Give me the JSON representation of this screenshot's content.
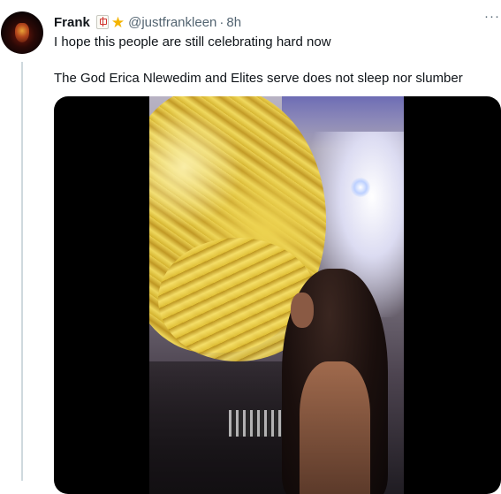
{
  "tweet": {
    "author": {
      "display_name": "Frank",
      "badges": [
        "mahjong-tile-emoji",
        "star-emoji"
      ],
      "handle": "@justfrankleen",
      "separator": "·",
      "time": "8h"
    },
    "more_menu": "···",
    "lines": [
      "I hope this people are still celebrating hard now",
      "The God Erica Nlewedim and Elites serve does not sleep nor slumber"
    ],
    "media": {
      "type": "video"
    }
  },
  "colors": {
    "text": "#0f1419",
    "secondary": "#536471",
    "thread_line": "#cfd9de",
    "star": "#f4b400",
    "media_bg": "#000000"
  }
}
